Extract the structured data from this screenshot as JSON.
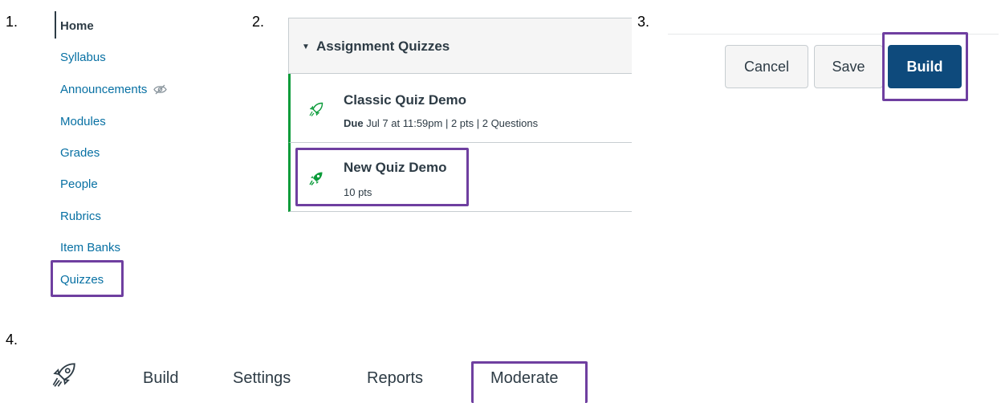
{
  "steps": [
    "1.",
    "2.",
    "3.",
    "4."
  ],
  "course_nav": {
    "items": [
      {
        "label": "Home",
        "active": true
      },
      {
        "label": "Syllabus"
      },
      {
        "label": "Announcements",
        "icon": "eye-slash-icon"
      },
      {
        "label": "Modules"
      },
      {
        "label": "Grades"
      },
      {
        "label": "People"
      },
      {
        "label": "Rubrics"
      },
      {
        "label": "Item Banks"
      },
      {
        "label": "Quizzes",
        "highlighted": true
      }
    ]
  },
  "assignments": {
    "group_title": "Assignment Quizzes",
    "items": [
      {
        "title": "Classic Quiz Demo",
        "due_label": "Due",
        "due_date": "Jul 7 at 11:59pm",
        "meta": " |  2 pts  |  2 Questions",
        "icon": "rocket-outline-icon"
      },
      {
        "title": "New Quiz Demo",
        "meta": "10 pts",
        "icon": "rocket-filled-icon",
        "highlighted": true
      }
    ]
  },
  "buttons": {
    "cancel": "Cancel",
    "save": "Save",
    "build": "Build"
  },
  "quiz_nav": {
    "icon": "rocket-outline-icon",
    "tabs": [
      "Build",
      "Settings",
      "Reports",
      "Moderate"
    ],
    "highlighted": "Moderate"
  },
  "colors": {
    "link": "#0770a3",
    "text": "#2d3b45",
    "accent_green": "#0b9b3a",
    "primary": "#0e4a7c",
    "highlight_box": "#6f3fa0"
  }
}
